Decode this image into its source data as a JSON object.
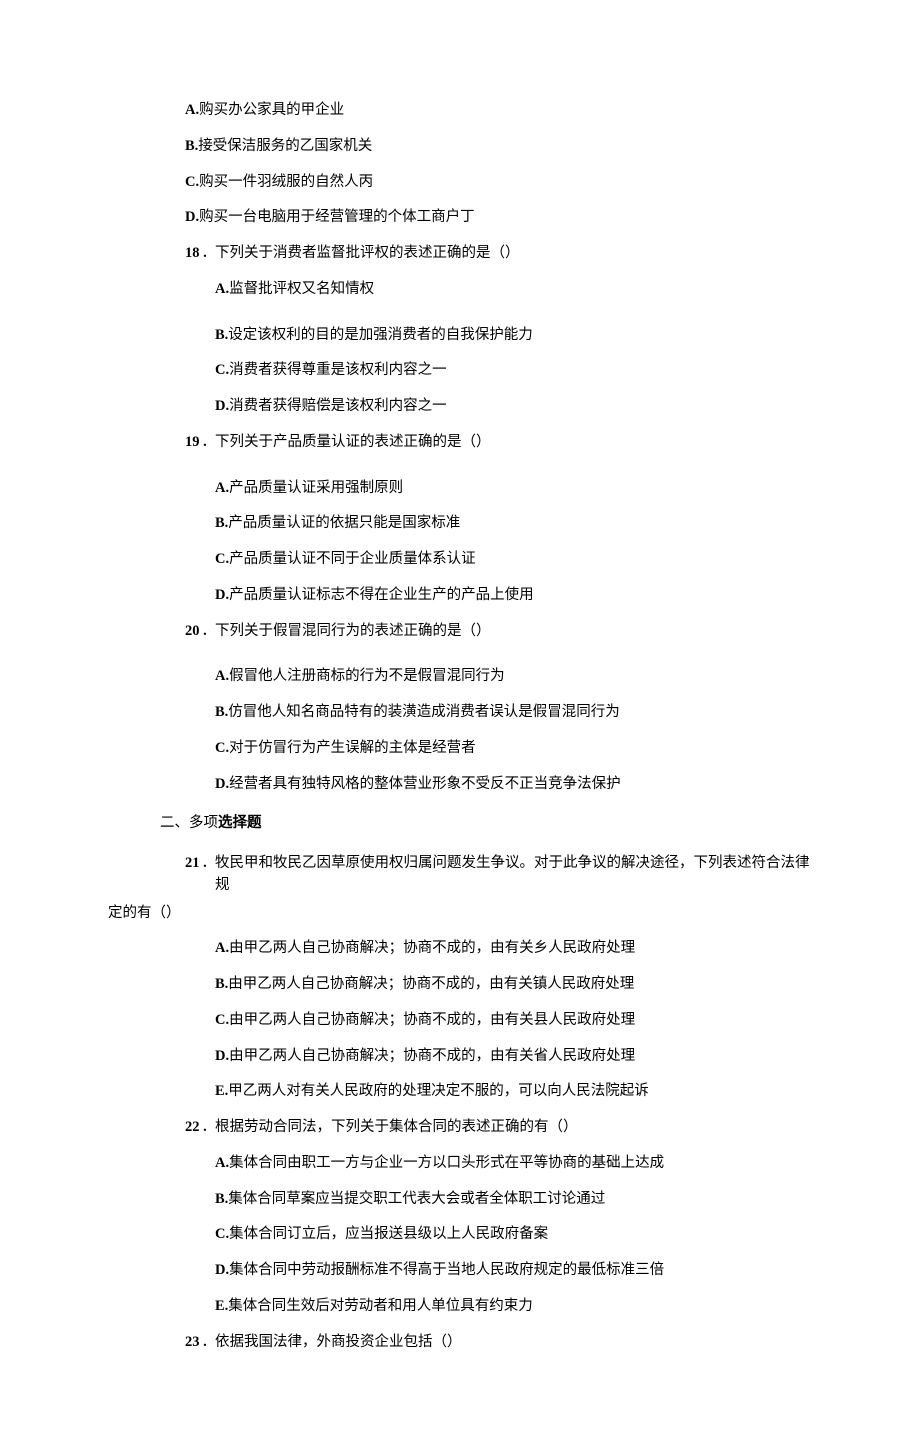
{
  "q17": {
    "optA": {
      "label": "A.",
      "text": "购买办公家具的甲企业"
    },
    "optB": {
      "label": "B.",
      "text": "接受保洁服务的乙国家机关"
    },
    "optC": {
      "label": "C.",
      "text": "购买一件羽绒服的自然人丙"
    },
    "optD": {
      "label": "D.",
      "text": "购买一台电脑用于经营管理的个体工商户丁"
    }
  },
  "q18": {
    "num": "18 .",
    "stem": "下列关于消费者监督批评权的表述正确的是（）",
    "optA": {
      "label": "A.",
      "text": "监督批评权又名知情权"
    },
    "optB": {
      "label": "B.",
      "text": "设定该权利的目的是加强消费者的自我保护能力"
    },
    "optC": {
      "label": "C.",
      "text": "消费者获得尊重是该权利内容之一"
    },
    "optD": {
      "label": "D.",
      "text": "消费者获得赔偿是该权利内容之一"
    }
  },
  "q19": {
    "num": "19 .",
    "stem": "下列关于产品质量认证的表述正确的是（）",
    "optA": {
      "label": "A.",
      "text": "产品质量认证采用强制原则"
    },
    "optB": {
      "label": "B.",
      "text": "产品质量认证的依据只能是国家标准"
    },
    "optC": {
      "label": "C.",
      "text": "产品质量认证不同于企业质量体系认证"
    },
    "optD": {
      "label": "D.",
      "text": "产品质量认证标志不得在企业生产的产品上使用"
    }
  },
  "q20": {
    "num": "20 .",
    "stem": "下列关于假冒混同行为的表述正确的是（）",
    "optA": {
      "label": "A.",
      "text": "假冒他人注册商标的行为不是假冒混同行为"
    },
    "optB": {
      "label": "B.",
      "text": "仿冒他人知名商品特有的装潢造成消费者误认是假冒混同行为"
    },
    "optC": {
      "label": "C.",
      "text": "对于仿冒行为产生误解的主体是经营者"
    },
    "optD": {
      "label": "D.",
      "text": "经营者具有独特风格的整体营业形象不受反不正当竞争法保护"
    }
  },
  "section2_heading_prefix": "二、多项",
  "section2_heading_bold": "选择题",
  "q21": {
    "num": "21 .",
    "stem": "牧民甲和牧民乙因草原使用权归属问题发生争议。对于此争议的解决途径，下列表述符合法律规",
    "stem_tail": "定的有（）",
    "optA": {
      "label": "A.",
      "text": "由甲乙两人自己协商解决；协商不成的，由有关乡人民政府处理"
    },
    "optB": {
      "label": "B.",
      "text": "由甲乙两人自己协商解决；协商不成的，由有关镇人民政府处理"
    },
    "optC": {
      "label": "C.",
      "text": "由甲乙两人自己协商解决；协商不成的，由有关县人民政府处理"
    },
    "optD": {
      "label": "D.",
      "text": "由甲乙两人自己协商解决；协商不成的，由有关省人民政府处理"
    },
    "optE": {
      "label": "E.",
      "text": "甲乙两人对有关人民政府的处理决定不服的，可以向人民法院起诉"
    }
  },
  "q22": {
    "num": "22 .",
    "stem": "根据劳动合同法，下列关于集体合同的表述正确的有（）",
    "optA": {
      "label": "A.",
      "text": "集体合同由职工一方与企业一方以口头形式在平等协商的基础上达成"
    },
    "optB": {
      "label": "B.",
      "text": "集体合同草案应当提交职工代表大会或者全体职工讨论通过"
    },
    "optC": {
      "label": "C.",
      "text": "集体合同订立后，应当报送县级以上人民政府备案"
    },
    "optD": {
      "label": "D.",
      "text": "集体合同中劳动报酬标准不得高于当地人民政府规定的最低标准三倍"
    },
    "optE": {
      "label": "E.",
      "text": "集体合同生效后对劳动者和用人单位具有约束力"
    }
  },
  "q23": {
    "num": "23 .",
    "stem": "依据我国法律，外商投资企业包括（）"
  }
}
